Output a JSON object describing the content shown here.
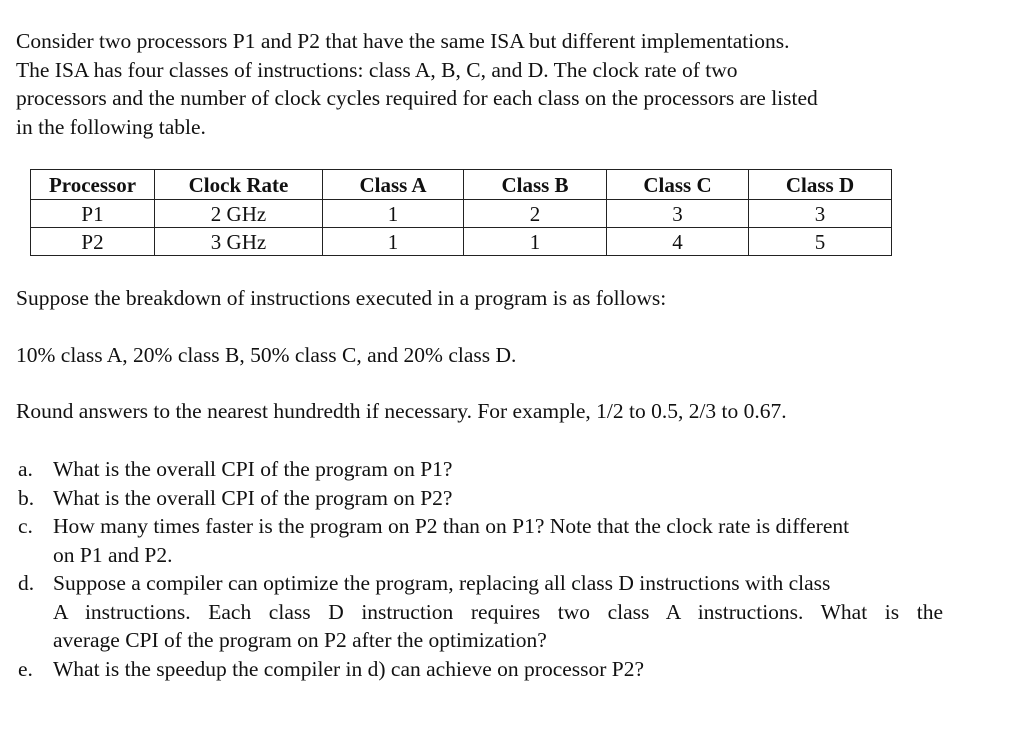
{
  "intro": {
    "lines": [
      "Consider two processors P1 and P2 that have the same ISA but different implementations.",
      "The ISA has four classes of instructions: class A, B, C, and D. The clock rate of two",
      "processors and the number of clock cycles required for each class on the processors are listed",
      "in the following table."
    ]
  },
  "table": {
    "headers": [
      "Processor",
      "Clock Rate",
      "Class A",
      "Class B",
      "Class C",
      "Class D"
    ],
    "rows": [
      [
        "P1",
        "2 GHz",
        "1",
        "2",
        "3",
        "3"
      ],
      [
        "P2",
        "3 GHz",
        "1",
        "1",
        "4",
        "5"
      ]
    ]
  },
  "paragraphs": {
    "breakdown_intro": "Suppose the breakdown of instructions executed in a program is as follows:",
    "breakdown": "10% class A, 20% class B, 50% class C, and 20% class D.",
    "rounding": "Round answers to the nearest hundredth if necessary. For example, 1/2 to 0.5, 2/3 to 0.67."
  },
  "questions": [
    {
      "label": "a.",
      "lines": [
        "What is the overall CPI of the program on P1?"
      ]
    },
    {
      "label": "b.",
      "lines": [
        "What is the overall CPI of the program on P2?"
      ]
    },
    {
      "label": "c.",
      "lines": [
        "How many times faster is the program on P2 than on P1? Note that the clock rate is different",
        "on P1 and P2."
      ]
    },
    {
      "label": "d.",
      "lines": [
        "Suppose a compiler can optimize the program, replacing all class D instructions with class",
        "A instructions. Each class D instruction requires two class A instructions. What is the",
        "average CPI of the program on P2 after the optimization?"
      ]
    },
    {
      "label": "e.",
      "lines": [
        "What is the speedup the compiler in d) can achieve on processor P2?"
      ]
    }
  ]
}
